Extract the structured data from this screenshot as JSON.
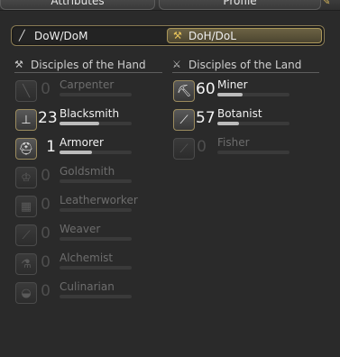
{
  "tabs": [
    {
      "label": "Attributes"
    },
    {
      "label": "Profile"
    }
  ],
  "segment": {
    "left": {
      "label": "DoW/DoM",
      "icon": "sword-icon"
    },
    "right": {
      "label": "DoH/DoL",
      "icon": "hammer-icon",
      "selected": true
    }
  },
  "hand": {
    "title": "Disciples of the Hand",
    "jobs": [
      {
        "name": "Carpenter",
        "level": "0",
        "active": false,
        "progress": 0,
        "icon": "saw-icon"
      },
      {
        "name": "Blacksmith",
        "level": "23",
        "active": true,
        "progress": 0.55,
        "icon": "anvil-icon"
      },
      {
        "name": "Armorer",
        "level": "1",
        "active": true,
        "progress": 0.45,
        "icon": "helmet-icon"
      },
      {
        "name": "Goldsmith",
        "level": "0",
        "active": false,
        "progress": 0,
        "icon": "tiara-icon"
      },
      {
        "name": "Leatherworker",
        "level": "0",
        "active": false,
        "progress": 0,
        "icon": "leather-icon"
      },
      {
        "name": "Weaver",
        "level": "0",
        "active": false,
        "progress": 0,
        "icon": "needle-icon"
      },
      {
        "name": "Alchemist",
        "level": "0",
        "active": false,
        "progress": 0,
        "icon": "flask-icon"
      },
      {
        "name": "Culinarian",
        "level": "0",
        "active": false,
        "progress": 0,
        "icon": "pot-icon"
      }
    ]
  },
  "land": {
    "title": "Disciples of the Land",
    "jobs": [
      {
        "name": "Miner",
        "level": "60",
        "active": true,
        "progress": 0.35,
        "icon": "pickaxe-icon"
      },
      {
        "name": "Botanist",
        "level": "57",
        "active": true,
        "progress": 0.3,
        "icon": "hatchet-icon"
      },
      {
        "name": "Fisher",
        "level": "0",
        "active": false,
        "progress": 0,
        "icon": "fishing-rod-icon"
      }
    ]
  }
}
